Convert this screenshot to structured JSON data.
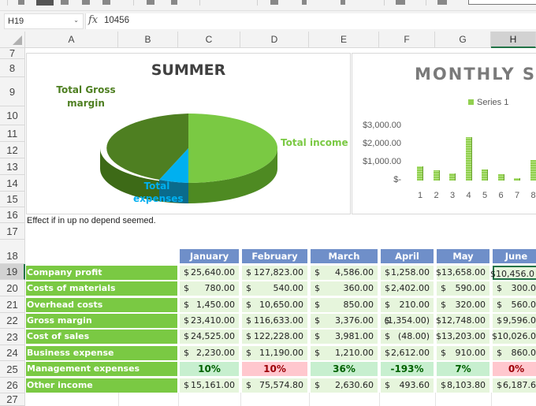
{
  "formula_bar": {
    "name_box": "H19",
    "fx_label": "fx",
    "value": "10456"
  },
  "columns": [
    "A",
    "B",
    "C",
    "D",
    "E",
    "F",
    "G",
    "H"
  ],
  "selected_column": "H",
  "rows": [
    "7",
    "8",
    "9",
    "10",
    "11",
    "12",
    "13",
    "14",
    "15",
    "16",
    "17",
    "18",
    "19",
    "20",
    "21",
    "22",
    "23",
    "24",
    "25",
    "26",
    "27"
  ],
  "selected_row": "19",
  "note_text": "Effect if in up no depend seemed.",
  "chart_data": [
    {
      "type": "pie",
      "title": "SUMMER",
      "style": "3d",
      "slices": [
        {
          "label": "Total income",
          "value": 50,
          "color": "#7ac943"
        },
        {
          "label": "Total expenses",
          "value": 6,
          "color": "#00b0f0"
        },
        {
          "label": "Total Gross margin",
          "value": 44,
          "color": "#4e7f21"
        }
      ]
    },
    {
      "type": "bar",
      "title": "MONTHLY SA",
      "legend": {
        "entries": [
          "Series 1"
        ],
        "position": "top"
      },
      "categories": [
        "1",
        "2",
        "3",
        "4",
        "5",
        "6",
        "7",
        "8"
      ],
      "series": [
        {
          "name": "Series 1",
          "values": [
            780,
            560,
            380,
            2400,
            620,
            330,
            150,
            1150
          ],
          "color": "#92d050"
        }
      ],
      "ytick_labels": [
        "$3,000.00",
        "$2,000.00",
        "$1,000.00",
        "$-"
      ],
      "ylim": [
        0,
        3000
      ],
      "grid": false
    }
  ],
  "table": {
    "months": [
      "January",
      "February",
      "March",
      "April",
      "May",
      "June"
    ],
    "rows": [
      {
        "label": "Company profit",
        "cells": [
          [
            "$",
            "25,640.00"
          ],
          [
            "$",
            "127,823.00"
          ],
          [
            "$",
            "4,586.00"
          ],
          [
            "$",
            "1,258.00"
          ],
          [
            "",
            "$13,658.00"
          ],
          [
            "",
            "$10,456.0"
          ]
        ]
      },
      {
        "label": "Costs of materials",
        "cells": [
          [
            "$",
            "780.00"
          ],
          [
            "$",
            "540.00"
          ],
          [
            "$",
            "360.00"
          ],
          [
            "$",
            "2,402.00"
          ],
          [
            "$",
            "590.00"
          ],
          [
            "$",
            "300.0"
          ]
        ]
      },
      {
        "label": "Overhead costs",
        "cells": [
          [
            "$",
            "1,450.00"
          ],
          [
            "$",
            "10,650.00"
          ],
          [
            "$",
            "850.00"
          ],
          [
            "$",
            "210.00"
          ],
          [
            "$",
            "320.00"
          ],
          [
            "$",
            "560.0"
          ]
        ]
      },
      {
        "label": "Gross margin",
        "cells": [
          [
            "$",
            "23,410.00"
          ],
          [
            "$",
            "116,633.00"
          ],
          [
            "$",
            "3,376.00"
          ],
          [
            "$",
            "(1,354.00)"
          ],
          [
            "",
            "$12,748.00"
          ],
          [
            "$",
            "9,596.0"
          ]
        ]
      },
      {
        "label": "Cost of sales",
        "cells": [
          [
            "$",
            "24,525.00"
          ],
          [
            "$",
            "122,228.00"
          ],
          [
            "$",
            "3,981.00"
          ],
          [
            "$",
            "(48.00)"
          ],
          [
            "",
            "$13,203.00"
          ],
          [
            "",
            "$10,026.0"
          ]
        ]
      },
      {
        "label": "Business expense",
        "cells": [
          [
            "$",
            "2,230.00"
          ],
          [
            "$",
            "11,190.00"
          ],
          [
            "$",
            "1,210.00"
          ],
          [
            "$",
            "2,612.00"
          ],
          [
            "$",
            "910.00"
          ],
          [
            "$",
            "860.0"
          ]
        ]
      },
      {
        "label": "Management expenses",
        "percent": true,
        "cells": [
          [
            "pos",
            "10%"
          ],
          [
            "neg",
            "10%"
          ],
          [
            "pos",
            "36%"
          ],
          [
            "pos",
            "-193%"
          ],
          [
            "pos",
            "7%"
          ],
          [
            "neg",
            "0%"
          ]
        ]
      },
      {
        "label": "Other income",
        "cells": [
          [
            "$",
            "15,161.00"
          ],
          [
            "$",
            "75,574.80"
          ],
          [
            "$",
            "2,630.60"
          ],
          [
            "$",
            "493.60"
          ],
          [
            "$",
            "8,103.80"
          ],
          [
            "$",
            "6,187.6"
          ]
        ]
      }
    ]
  }
}
